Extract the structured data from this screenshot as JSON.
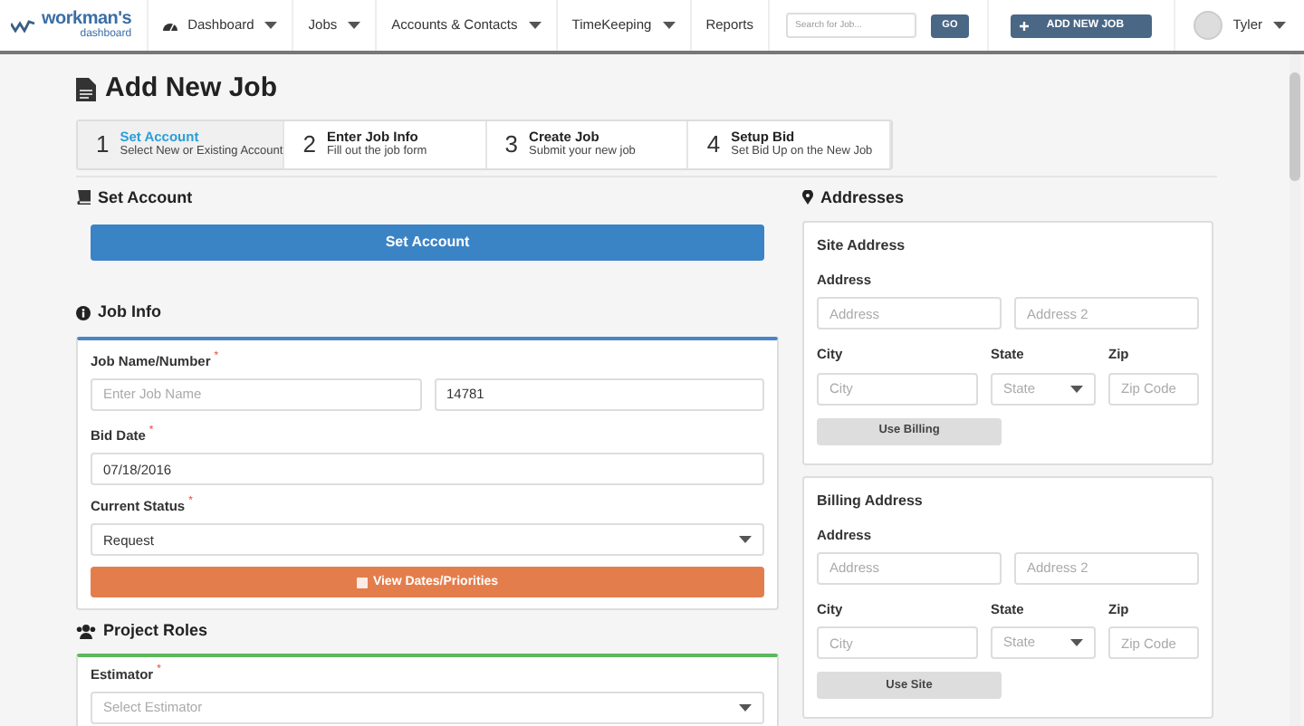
{
  "nav": {
    "logo": "workman's",
    "logo_sub": "dashboard",
    "items": [
      {
        "label": "Dashboard",
        "dropdown": true,
        "kind": "gauge"
      },
      {
        "label": "Jobs",
        "dropdown": true
      },
      {
        "label": "Accounts & Contacts",
        "dropdown": true
      },
      {
        "label": "TimeKeeping",
        "dropdown": true
      },
      {
        "label": "Reports",
        "dropdown": false
      }
    ],
    "search": {
      "placeholder": "Search for Job..."
    },
    "go": "GO",
    "add_job": "ADD NEW JOB",
    "user": "Tyler"
  },
  "title": "Add New Job",
  "steps": [
    {
      "number": "1",
      "title": "Set Account",
      "subtitle": "Select New or Existing Account",
      "selected": true
    },
    {
      "number": "2",
      "title": "Enter Job Info",
      "subtitle": "Fill out the job form",
      "selected": false
    },
    {
      "number": "3",
      "title": "Create Job",
      "subtitle": "Submit your new job",
      "selected": false
    },
    {
      "number": "4",
      "title": "Setup Bid",
      "subtitle": "Set Bid Up on the New Job",
      "selected": false
    }
  ],
  "set_account": {
    "heading": "Set Account",
    "button": "Set Account"
  },
  "job_info": {
    "heading": "Job Info",
    "required_mark": "*",
    "name_label": "Job Name/Number",
    "name_placeholder": "Enter Job Name",
    "number_value": "14781",
    "bid_label": "Bid Date",
    "bid_value": "07/18/2016",
    "status_label": "Current Status",
    "status_value": "Request",
    "dates_button": "View Dates/Priorities"
  },
  "project_roles": {
    "heading": "Project Roles",
    "required_mark": "*",
    "estimator_label": "Estimator",
    "estimator_placeholder": "Select Estimator"
  },
  "addresses": {
    "heading": "Addresses",
    "cards": [
      {
        "title": "Site Address",
        "address_label": "Address",
        "address_placeholder": "Address",
        "address2_placeholder": "Address 2",
        "city_label": "City",
        "city_placeholder": "City",
        "state_label": "State",
        "state_placeholder": "State",
        "zip_label": "Zip",
        "zip_placeholder": "Zip Code",
        "button": "Use Billing"
      },
      {
        "title": "Billing Address",
        "address_label": "Address",
        "address_placeholder": "Address",
        "address2_placeholder": "Address 2",
        "city_label": "City",
        "city_placeholder": "City",
        "state_label": "State",
        "state_placeholder": "State",
        "zip_label": "Zip",
        "zip_placeholder": "Zip Code",
        "button": "Use Site"
      }
    ]
  }
}
